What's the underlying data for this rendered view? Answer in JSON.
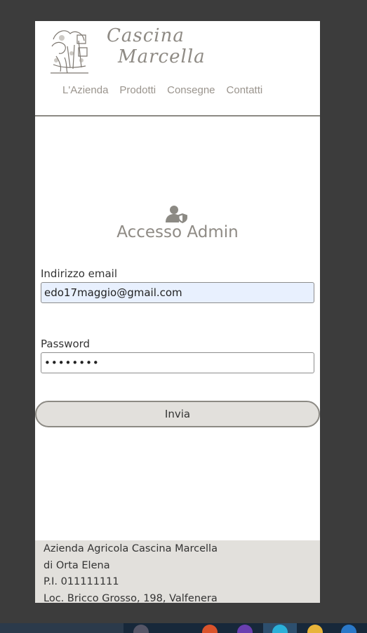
{
  "brand": {
    "line1": "Cascina",
    "line2": "Marcella"
  },
  "nav": [
    "L'Azienda",
    "Prodotti",
    "Consegne",
    "Contatti"
  ],
  "login": {
    "title": "Accesso Admin",
    "email_label": "Indirizzo email",
    "email_value": "edo17maggio@gmail.com",
    "password_label": "Password",
    "password_value": "••••••••",
    "submit_label": "Invia"
  },
  "footer": {
    "line1": "Azienda Agricola Cascina Marcella",
    "line2": "di Orta Elena",
    "line3": "P.I. 011111111",
    "line4": "Loc. Bricco Grosso, 198, Valfenera"
  },
  "colors": {
    "background": "#3c3c3c",
    "accent": "#8c8a84",
    "footer_bg": "#e2e0dc",
    "taskbar": "#17283a"
  },
  "icons": [
    "logo-illustration",
    "admin-user-shield-icon"
  ]
}
